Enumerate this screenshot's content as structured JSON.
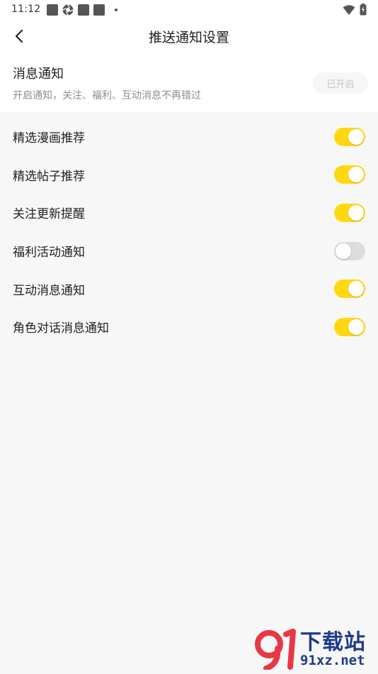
{
  "status_bar": {
    "time": "11:12",
    "icons": [
      "square-notification-icon",
      "aperture-icon",
      "square-notification-icon",
      "square-notification-icon",
      "dot-icon"
    ],
    "right_icons": [
      "wifi-icon",
      "battery-icon"
    ]
  },
  "header": {
    "back_icon": "chevron-left-icon",
    "title": "推送通知设置"
  },
  "master": {
    "title": "消息通知",
    "description": "开启通知，关注、福利、互动消息不再错过",
    "status_label": "已开启"
  },
  "settings": [
    {
      "label": "精选漫画推荐",
      "enabled": true
    },
    {
      "label": "精选帖子推荐",
      "enabled": true
    },
    {
      "label": "关注更新提醒",
      "enabled": true
    },
    {
      "label": "福利活动通知",
      "enabled": false
    },
    {
      "label": "互动消息通知",
      "enabled": true
    },
    {
      "label": "角色对话消息通知",
      "enabled": true
    }
  ],
  "colors": {
    "toggle_on": "#ffd812",
    "toggle_off": "#dcdcdc",
    "background": "#f7f7f7",
    "watermark": "#1f3a8a"
  },
  "watermark": {
    "title": "下载站",
    "url": "91xz.net"
  }
}
